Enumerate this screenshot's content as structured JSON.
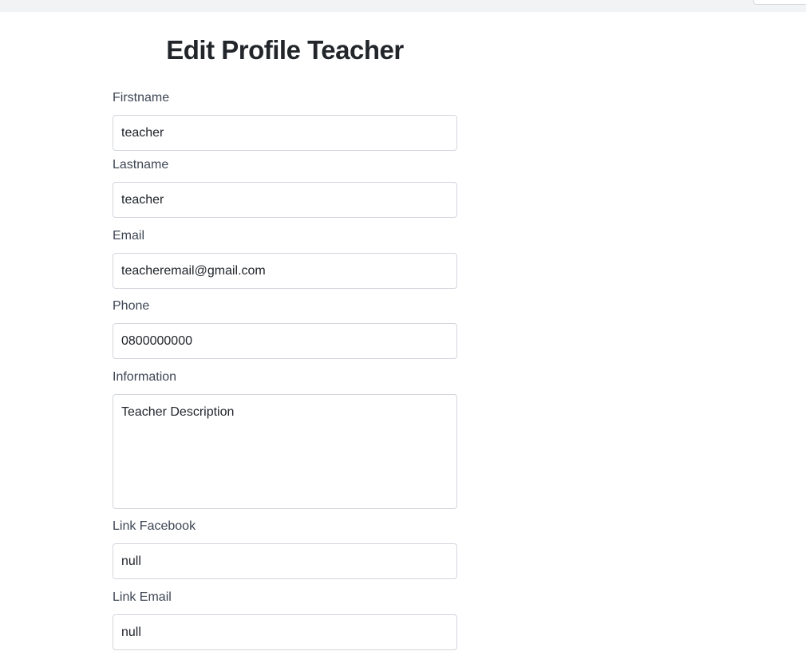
{
  "page": {
    "title": "Edit Profile Teacher"
  },
  "form": {
    "firstname": {
      "label": "Firstname",
      "value": "teacher"
    },
    "lastname": {
      "label": "Lastname",
      "value": "teacher"
    },
    "email": {
      "label": "Email",
      "value": "teacheremail@gmail.com"
    },
    "phone": {
      "label": "Phone",
      "value": "0800000000"
    },
    "information": {
      "label": "Information",
      "value": "Teacher Description"
    },
    "link_facebook": {
      "label": "Link Facebook",
      "value": "null"
    },
    "link_email": {
      "label": "Link Email",
      "value": "null"
    }
  }
}
